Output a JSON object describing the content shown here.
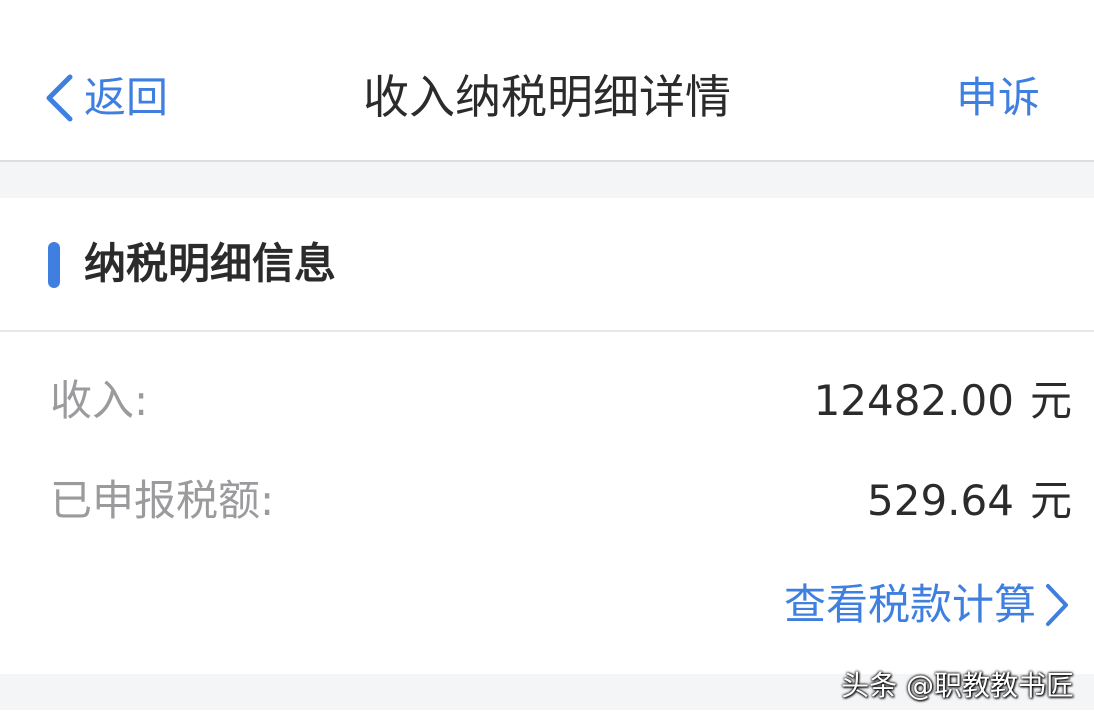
{
  "nav": {
    "back_label": "返回",
    "title": "收入纳税明细详情",
    "appeal_label": "申诉"
  },
  "section": {
    "title": "纳税明细信息"
  },
  "details": {
    "income": {
      "label": "收入:",
      "value": "12482.00",
      "unit": "元"
    },
    "declared_tax": {
      "label": "已申报税额:",
      "value": "529.64",
      "unit": "元"
    }
  },
  "tax_calc_link": {
    "label": "查看税款计算"
  },
  "watermark": {
    "text": "头条 @职教教书匠"
  },
  "icons": {
    "back": "chevron-left-icon",
    "link": "chevron-right-icon"
  },
  "colors": {
    "accent": "#3f7fe0",
    "text_primary": "#2b2b2b",
    "text_secondary": "#9b9b9e",
    "page_background": "#f4f5f7"
  }
}
